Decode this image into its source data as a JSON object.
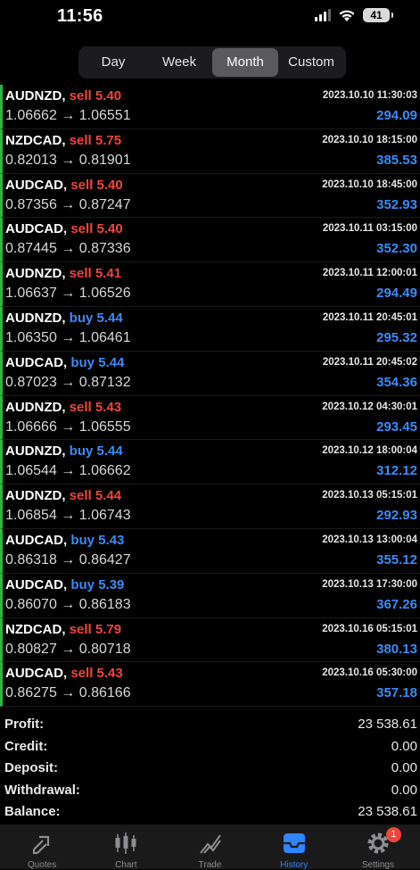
{
  "status_bar": {
    "time": "11:56",
    "battery": "41"
  },
  "period_tabs": [
    {
      "label": "Day",
      "active": false
    },
    {
      "label": "Week",
      "active": false
    },
    {
      "label": "Month",
      "active": true
    },
    {
      "label": "Custom",
      "active": false
    }
  ],
  "deals": [
    {
      "symbol": "AUDNZD,",
      "side": "sell",
      "volume": "5.40",
      "open_price": "1.06662",
      "close_price": "1.06551",
      "time": "2023.10.10 11:30:03",
      "profit": "294.09"
    },
    {
      "symbol": "NZDCAD,",
      "side": "sell",
      "volume": "5.75",
      "open_price": "0.82013",
      "close_price": "0.81901",
      "time": "2023.10.10 18:15:00",
      "profit": "385.53"
    },
    {
      "symbol": "AUDCAD,",
      "side": "sell",
      "volume": "5.40",
      "open_price": "0.87356",
      "close_price": "0.87247",
      "time": "2023.10.10 18:45:00",
      "profit": "352.93"
    },
    {
      "symbol": "AUDCAD,",
      "side": "sell",
      "volume": "5.40",
      "open_price": "0.87445",
      "close_price": "0.87336",
      "time": "2023.10.11 03:15:00",
      "profit": "352.30"
    },
    {
      "symbol": "AUDNZD,",
      "side": "sell",
      "volume": "5.41",
      "open_price": "1.06637",
      "close_price": "1.06526",
      "time": "2023.10.11 12:00:01",
      "profit": "294.49"
    },
    {
      "symbol": "AUDNZD,",
      "side": "buy",
      "volume": "5.44",
      "open_price": "1.06350",
      "close_price": "1.06461",
      "time": "2023.10.11 20:45:01",
      "profit": "295.32"
    },
    {
      "symbol": "AUDCAD,",
      "side": "buy",
      "volume": "5.44",
      "open_price": "0.87023",
      "close_price": "0.87132",
      "time": "2023.10.11 20:45:02",
      "profit": "354.36"
    },
    {
      "symbol": "AUDNZD,",
      "side": "sell",
      "volume": "5.43",
      "open_price": "1.06666",
      "close_price": "1.06555",
      "time": "2023.10.12 04:30:01",
      "profit": "293.45"
    },
    {
      "symbol": "AUDNZD,",
      "side": "buy",
      "volume": "5.44",
      "open_price": "1.06544",
      "close_price": "1.06662",
      "time": "2023.10.12 18:00:04",
      "profit": "312.12"
    },
    {
      "symbol": "AUDNZD,",
      "side": "sell",
      "volume": "5.44",
      "open_price": "1.06854",
      "close_price": "1.06743",
      "time": "2023.10.13 05:15:01",
      "profit": "292.93"
    },
    {
      "symbol": "AUDCAD,",
      "side": "buy",
      "volume": "5.43",
      "open_price": "0.86318",
      "close_price": "0.86427",
      "time": "2023.10.13 13:00:04",
      "profit": "355.12"
    },
    {
      "symbol": "AUDCAD,",
      "side": "buy",
      "volume": "5.39",
      "open_price": "0.86070",
      "close_price": "0.86183",
      "time": "2023.10.13 17:30:00",
      "profit": "367.26"
    },
    {
      "symbol": "NZDCAD,",
      "side": "sell",
      "volume": "5.79",
      "open_price": "0.80827",
      "close_price": "0.80718",
      "time": "2023.10.16 05:15:01",
      "profit": "380.13"
    },
    {
      "symbol": "AUDCAD,",
      "side": "sell",
      "volume": "5.43",
      "open_price": "0.86275",
      "close_price": "0.86166",
      "time": "2023.10.16 05:30:00",
      "profit": "357.18"
    }
  ],
  "arrow": "→",
  "summary": [
    {
      "label": "Profit:",
      "value": "23 538.61"
    },
    {
      "label": "Credit:",
      "value": "0.00"
    },
    {
      "label": "Deposit:",
      "value": "0.00"
    },
    {
      "label": "Withdrawal:",
      "value": "0.00"
    },
    {
      "label": "Balance:",
      "value": "23 538.61"
    }
  ],
  "tab_bar": [
    {
      "label": "Quotes",
      "icon": "quotes-arrows-icon",
      "active": false
    },
    {
      "label": "Chart",
      "icon": "candlestick-icon",
      "active": false
    },
    {
      "label": "Trade",
      "icon": "trade-line-icon",
      "active": false
    },
    {
      "label": "History",
      "icon": "inbox-tray-icon",
      "active": true
    },
    {
      "label": "Settings",
      "icon": "gear-icon",
      "active": false,
      "badge": "1"
    }
  ],
  "colors": {
    "sell": "#f0453c",
    "buy": "#3b8bf6",
    "profit": "#3b8bf6",
    "active_tab": "#2f86ff",
    "row_marker": "#2ab74a"
  }
}
